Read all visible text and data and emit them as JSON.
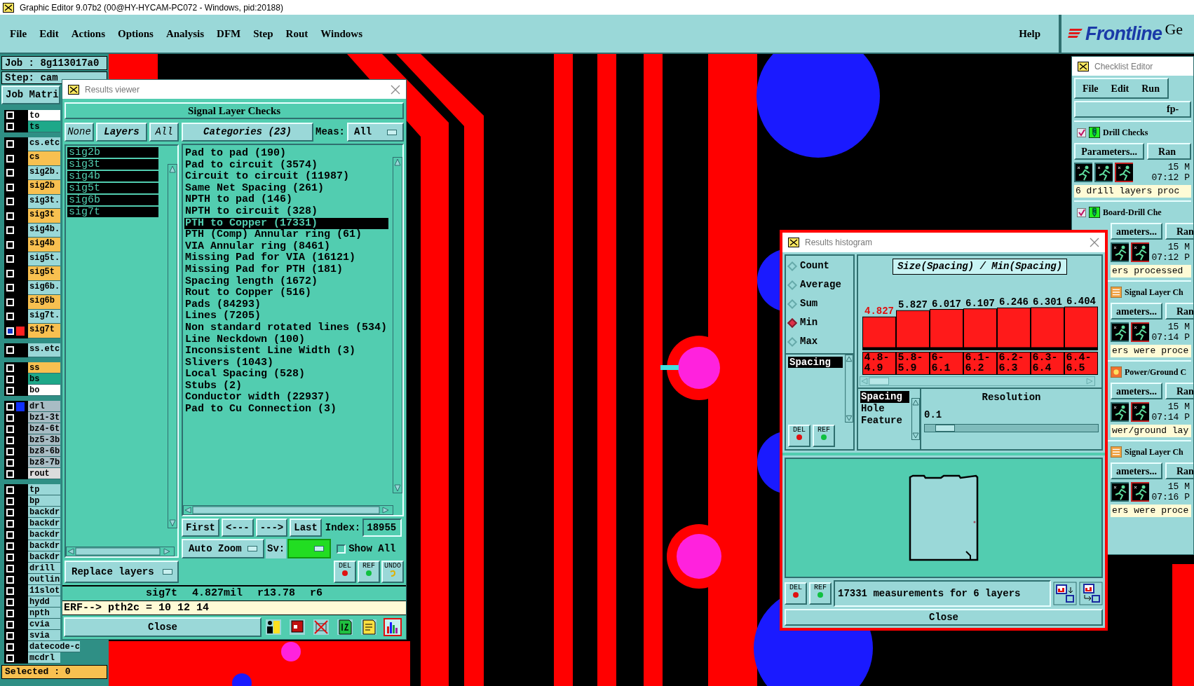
{
  "window": {
    "title": "Graphic Editor 9.07b2 (00@HY-HYCAM-PC072 - Windows, pid:20188)"
  },
  "menu": [
    "File",
    "Edit",
    "Actions",
    "Options",
    "Analysis",
    "DFM",
    "Step",
    "Rout",
    "Windows"
  ],
  "help_menu": "Help",
  "logo": {
    "brand": "Frontline",
    "extra": "Ge"
  },
  "left_panel": {
    "job": "Job : 8g113017a0",
    "step": "Step: cam",
    "matrix_button": "Job Matri",
    "selected_count": "Selected : 0",
    "layer_groups": [
      [
        {
          "name": "to",
          "color": "#ffffff",
          "selected": false
        },
        {
          "name": "ts",
          "color": "#1ea889",
          "selected": false
        }
      ],
      [
        {
          "name": "cs.etc",
          "color": "#9ad8d8",
          "selected": false
        },
        {
          "name": "cs",
          "color": "#f8c050",
          "selected": false
        },
        {
          "name": "sig2b.",
          "color": "#9ad8d8",
          "selected": false
        },
        {
          "name": "sig2b",
          "color": "#f8c050",
          "selected": false
        },
        {
          "name": "sig3t.",
          "color": "#9ad8d8",
          "selected": false
        },
        {
          "name": "sig3t",
          "color": "#f8c050",
          "selected": false
        },
        {
          "name": "sig4b.",
          "color": "#9ad8d8",
          "selected": false
        },
        {
          "name": "sig4b",
          "color": "#f8c050",
          "selected": false
        },
        {
          "name": "sig5t.",
          "color": "#9ad8d8",
          "selected": false
        },
        {
          "name": "sig5t",
          "color": "#f8c050",
          "selected": false
        },
        {
          "name": "sig6b.",
          "color": "#9ad8d8",
          "selected": false
        },
        {
          "name": "sig6b",
          "color": "#f8c050",
          "selected": false
        },
        {
          "name": "sig7t.",
          "color": "#9ad8d8",
          "selected": false
        },
        {
          "name": "sig7t",
          "color": "#f8c050",
          "selected": true,
          "swatch": {
            "color": "#ff2020"
          }
        }
      ],
      [
        {
          "name": "ss.etc",
          "color": "#9ad8d8",
          "selected": false
        }
      ],
      [
        {
          "name": "ss",
          "color": "#f8c050",
          "selected": false
        },
        {
          "name": "bs",
          "color": "#1ea889",
          "selected": false
        },
        {
          "name": "bo",
          "color": "#ffffff",
          "selected": false
        }
      ],
      [
        {
          "name": "drl",
          "color": "#a8bcc4",
          "selected": false,
          "swatch": {
            "color": "#1030ff"
          }
        },
        {
          "name": "bz1-3t",
          "color": "#a8bcc4",
          "selected": false
        },
        {
          "name": "bz4-6t",
          "color": "#a8bcc4",
          "selected": false
        },
        {
          "name": "bz5-3b",
          "color": "#a8bcc4",
          "selected": false
        },
        {
          "name": "bz8-6b",
          "color": "#a8bcc4",
          "selected": false
        },
        {
          "name": "bz8-7b",
          "color": "#a8bcc4",
          "selected": false
        },
        {
          "name": "rout",
          "color": "#dcdcdc",
          "selected": false
        }
      ],
      [
        {
          "name": "tp",
          "color": "#9ad8d8",
          "selected": false
        },
        {
          "name": "bp",
          "color": "#9ad8d8",
          "selected": false
        },
        {
          "name": "backdr",
          "color": "#9ad8d8",
          "selected": false
        },
        {
          "name": "backdr",
          "color": "#9ad8d8",
          "selected": false
        },
        {
          "name": "backdr",
          "color": "#9ad8d8",
          "selected": false
        },
        {
          "name": "backdr",
          "color": "#9ad8d8",
          "selected": false
        },
        {
          "name": "backdr",
          "color": "#9ad8d8",
          "selected": false
        },
        {
          "name": "drill",
          "color": "#9ad8d8",
          "selected": false
        },
        {
          "name": "outlin",
          "color": "#9ad8d8",
          "selected": false
        },
        {
          "name": "11slot",
          "color": "#9ad8d8",
          "selected": false
        },
        {
          "name": "hydd",
          "color": "#9ad8d8",
          "selected": false
        },
        {
          "name": "npth",
          "color": "#9ad8d8",
          "selected": false
        },
        {
          "name": "cvia",
          "color": "#9ad8d8",
          "selected": false
        },
        {
          "name": "svia",
          "color": "#9ad8d8",
          "selected": false
        },
        {
          "name": "datecode-c",
          "color": "#9ad8d8",
          "selected": false
        },
        {
          "name": "mcdrl",
          "color": "#9ad8d8",
          "selected": false
        }
      ]
    ]
  },
  "results_viewer": {
    "title": "Results viewer",
    "heading": "Signal Layer Checks",
    "layer_buttons": [
      {
        "label": "None",
        "kind": "plain"
      },
      {
        "label": "Layers",
        "kind": "header"
      },
      {
        "label": "All",
        "kind": "plain"
      }
    ],
    "layers": [
      {
        "label": "sig2b",
        "selected": true
      },
      {
        "label": "sig3t",
        "selected": true
      },
      {
        "label": "sig4b",
        "selected": true
      },
      {
        "label": "sig5t",
        "selected": true
      },
      {
        "label": "sig6b",
        "selected": true
      },
      {
        "label": "sig7t",
        "selected": true
      }
    ],
    "categories_button": "Categories (23)",
    "meas_label": "Meas:",
    "meas_value": "All",
    "categories": [
      {
        "label": "Pad to pad (190)",
        "selected": false
      },
      {
        "label": "Pad to circuit (3574)",
        "selected": false
      },
      {
        "label": "Circuit to circuit (11987)",
        "selected": false
      },
      {
        "label": "Same Net Spacing (261)",
        "selected": false
      },
      {
        "label": "NPTH to pad (146)",
        "selected": false
      },
      {
        "label": "NPTH to circuit (328)",
        "selected": false
      },
      {
        "label": "PTH to Copper (17331)",
        "selected": true
      },
      {
        "label": "PTH (Comp) Annular ring (61)",
        "selected": false
      },
      {
        "label": "VIA Annular ring (8461)",
        "selected": false
      },
      {
        "label": "Missing Pad for VIA (16121)",
        "selected": false
      },
      {
        "label": "Missing Pad for PTH (181)",
        "selected": false
      },
      {
        "label": "Spacing length (1672)",
        "selected": false
      },
      {
        "label": "Rout to Copper (516)",
        "selected": false
      },
      {
        "label": "Pads (84293)",
        "selected": false
      },
      {
        "label": "Lines (7205)",
        "selected": false
      },
      {
        "label": "Non standard rotated lines (534)",
        "selected": false
      },
      {
        "label": "Line Neckdown (100)",
        "selected": false
      },
      {
        "label": "Inconsistent Line Width (3)",
        "selected": false
      },
      {
        "label": "Slivers (1043)",
        "selected": false
      },
      {
        "label": "Local Spacing (528)",
        "selected": false
      },
      {
        "label": "Stubs (2)",
        "selected": false
      },
      {
        "label": "Conductor width (22937)",
        "selected": false
      },
      {
        "label": "Pad to Cu Connection (3)",
        "selected": false
      }
    ],
    "nav_buttons": [
      "First",
      "<---",
      "--->",
      "Last"
    ],
    "index_label": "Index:",
    "index_value": "18955",
    "zoom_mode": "Auto Zoom",
    "sv_label": "Sv:",
    "show_all": {
      "label": "Show All",
      "checked": false
    },
    "replace_mode": "Replace layers",
    "edit_buttons": [
      {
        "label": "DEL",
        "kind": "delete"
      },
      {
        "label": "REF",
        "kind": "refer"
      },
      {
        "label": "UNDO",
        "kind": "undo"
      }
    ],
    "status": "sig7t 4.827mil r13.78 r6",
    "erf_line": "ERF--> pth2c = 10 12 14",
    "close": "Close"
  },
  "histogram": {
    "title": "Results histogram",
    "modes": [
      {
        "label": "Count",
        "selected": false
      },
      {
        "label": "Average",
        "selected": false
      },
      {
        "label": "Sum",
        "selected": false
      },
      {
        "label": "Min",
        "selected": true
      },
      {
        "label": "Max",
        "selected": false
      }
    ],
    "measures": [
      {
        "label": "Spacing",
        "selected": true
      }
    ],
    "mode_buttons": [
      {
        "label": "DEL",
        "kind": "delete"
      },
      {
        "label": "REF",
        "kind": "refer"
      }
    ],
    "chart_data": {
      "type": "bar",
      "title": "Size(Spacing) / Min(Spacing)",
      "categories": [
        "4.8-4.9",
        "5.8-5.9",
        "6-6.1",
        "6.1-6.2",
        "6.2-6.3",
        "6.3-6.4",
        "6.4-6.5"
      ],
      "values": [
        4.827,
        5.827,
        6.017,
        6.107,
        6.246,
        6.301,
        6.404
      ],
      "value_labels": [
        "4.827",
        "5.827",
        "6.017",
        "6.107",
        "6.246",
        "6.301",
        "6.404"
      ]
    },
    "attributes": [
      {
        "label": "Spacing",
        "selected": true
      },
      {
        "label": "Hole",
        "selected": false
      },
      {
        "label": "Feature",
        "selected": false
      }
    ],
    "resolution": {
      "label": "Resolution",
      "value": "0.1",
      "level": 0.06
    },
    "footer_buttons": [
      {
        "label": "DEL",
        "kind": "delete"
      },
      {
        "label": "REF",
        "kind": "refer"
      }
    ],
    "summary": "17331 measurements for 6 layers",
    "close": "Close"
  },
  "checklist": {
    "title": "Checklist Editor",
    "menu": [
      "File",
      "Edit",
      "Run"
    ],
    "name": "fp-",
    "items": [
      {
        "kind": "drill",
        "title": "Drill Checks",
        "checked": true,
        "params": "Parameters...",
        "run": "Ran",
        "date": "15 M",
        "time": "07:12 P",
        "message": "6 drill layers proc"
      },
      {
        "kind": "drill",
        "title": "Board-Drill Che",
        "checked": true,
        "params": "ameters...",
        "run": "Ran",
        "date": "15 M",
        "time": "07:12 P",
        "message": "ers processed"
      },
      {
        "kind": "signal",
        "title": "Signal Layer Ch",
        "params": "ameters...",
        "run": "Ran",
        "date": "15 M",
        "time": "07:14 P",
        "message": "ers were proce"
      },
      {
        "kind": "power",
        "title": "Power/Ground C",
        "params": "ameters...",
        "run": "Ran",
        "date": "15 M",
        "time": "07:14 P",
        "message": "wer/ground lay"
      },
      {
        "kind": "signal",
        "title": "Signal Layer Ch",
        "params": "ameters...",
        "run": "Ran",
        "date": "15 M",
        "time": "07:16 P",
        "message": "ers were proce"
      }
    ]
  }
}
